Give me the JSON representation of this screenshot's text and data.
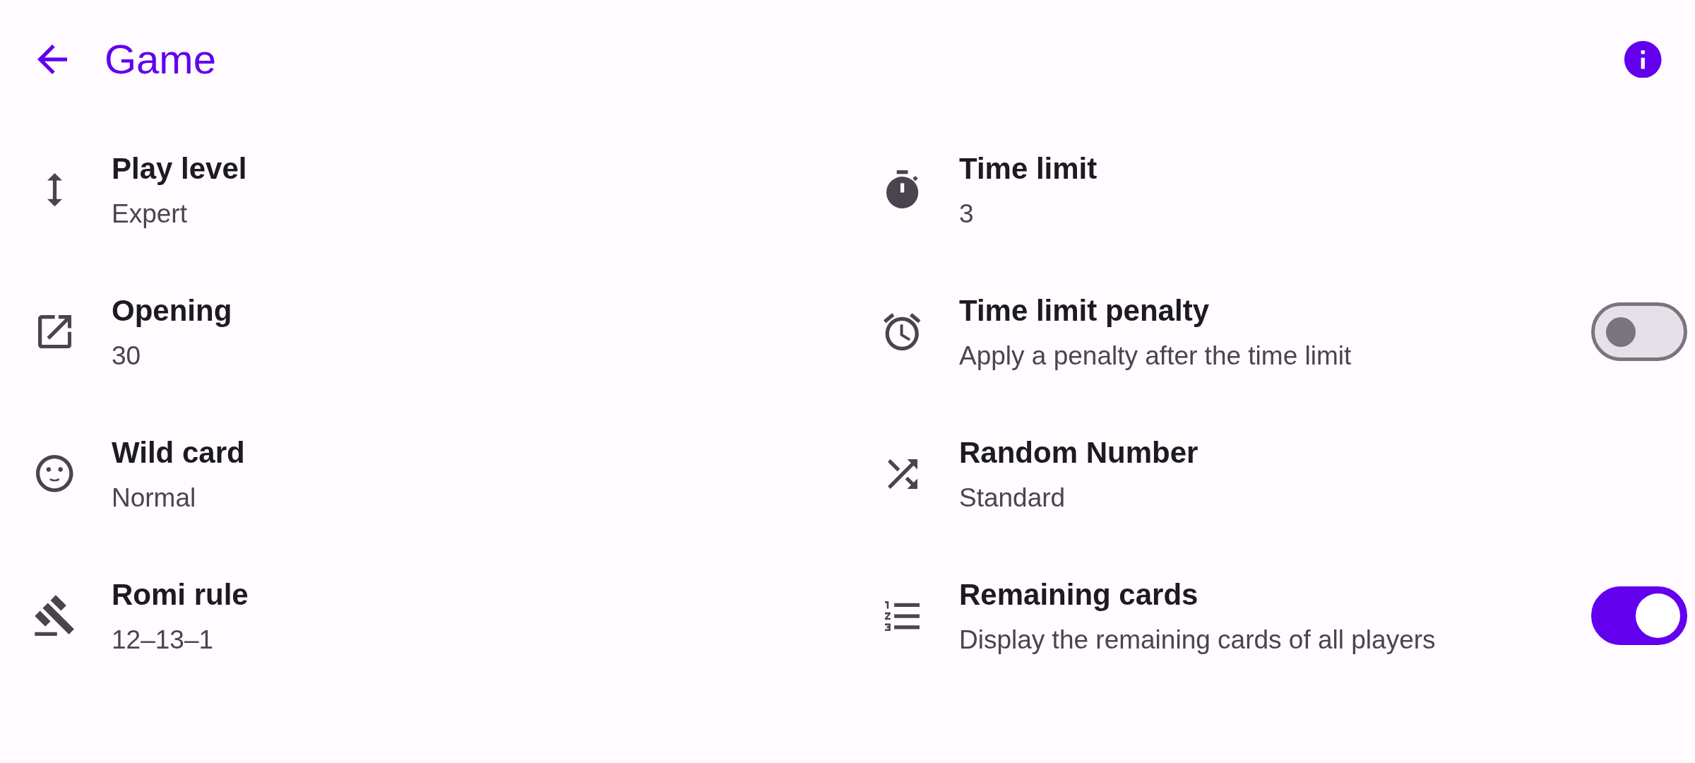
{
  "app_bar": {
    "title": "Game"
  },
  "settings": [
    {
      "kind": "value",
      "title": "Play level",
      "value": "Expert"
    },
    {
      "kind": "value",
      "title": "Time limit",
      "value": "3"
    },
    {
      "kind": "value",
      "title": "Opening",
      "value": "30"
    },
    {
      "kind": "switch",
      "title": "Time limit penalty",
      "summary": "Apply a penalty after the time limit",
      "on": false
    },
    {
      "kind": "value",
      "title": "Wild card",
      "value": "Normal"
    },
    {
      "kind": "value",
      "title": "Random Number",
      "value": "Standard"
    },
    {
      "kind": "value",
      "title": "Romi rule",
      "value": "12–13–1"
    },
    {
      "kind": "switch",
      "title": "Remaining cards",
      "summary": "Display the remaining cards of all players",
      "on": true
    }
  ]
}
